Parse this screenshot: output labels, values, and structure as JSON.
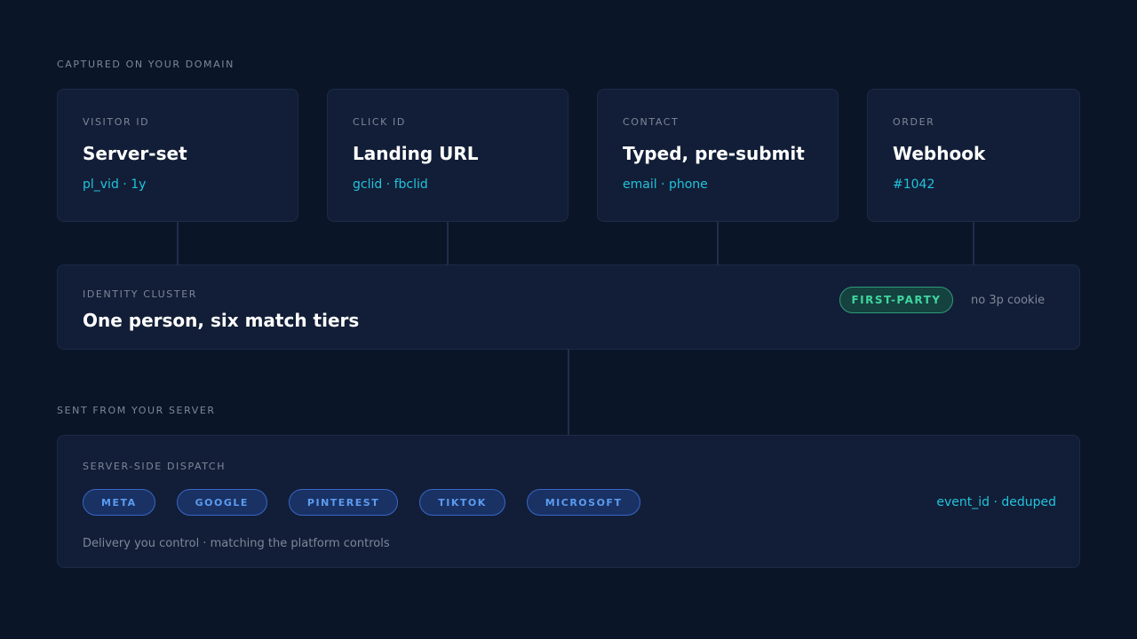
{
  "captured_section": {
    "label": "CAPTURED ON YOUR DOMAIN"
  },
  "sources": [
    {
      "label": "VISITOR ID",
      "title": "Server-set",
      "detail": "pl_vid · 1y"
    },
    {
      "label": "CLICK ID",
      "title": "Landing URL",
      "detail": "gclid · fbclid"
    },
    {
      "label": "CONTACT",
      "title": "Typed, pre-submit",
      "detail": "email · phone"
    },
    {
      "label": "ORDER",
      "title": "Webhook",
      "detail": "#1042"
    }
  ],
  "identity": {
    "label": "IDENTITY CLUSTER",
    "title": "One person, six match tiers",
    "badge": "FIRST-PARTY",
    "note": "no 3p cookie"
  },
  "sent_section": {
    "label": "SENT FROM YOUR SERVER"
  },
  "dispatch": {
    "label": "SERVER-SIDE DISPATCH",
    "platforms": [
      "META",
      "GOOGLE",
      "PINTEREST",
      "TIKTOK",
      "MICROSOFT"
    ],
    "event_note": "event_id · deduped",
    "footer": "Delivery you control · matching the platform controls"
  },
  "colors": {
    "background": "#0b1528",
    "card": "#121e37",
    "accent_cyan": "#22c3dd",
    "badge_green": "#3fd69e",
    "pill_blue": "#5b9cf0"
  }
}
